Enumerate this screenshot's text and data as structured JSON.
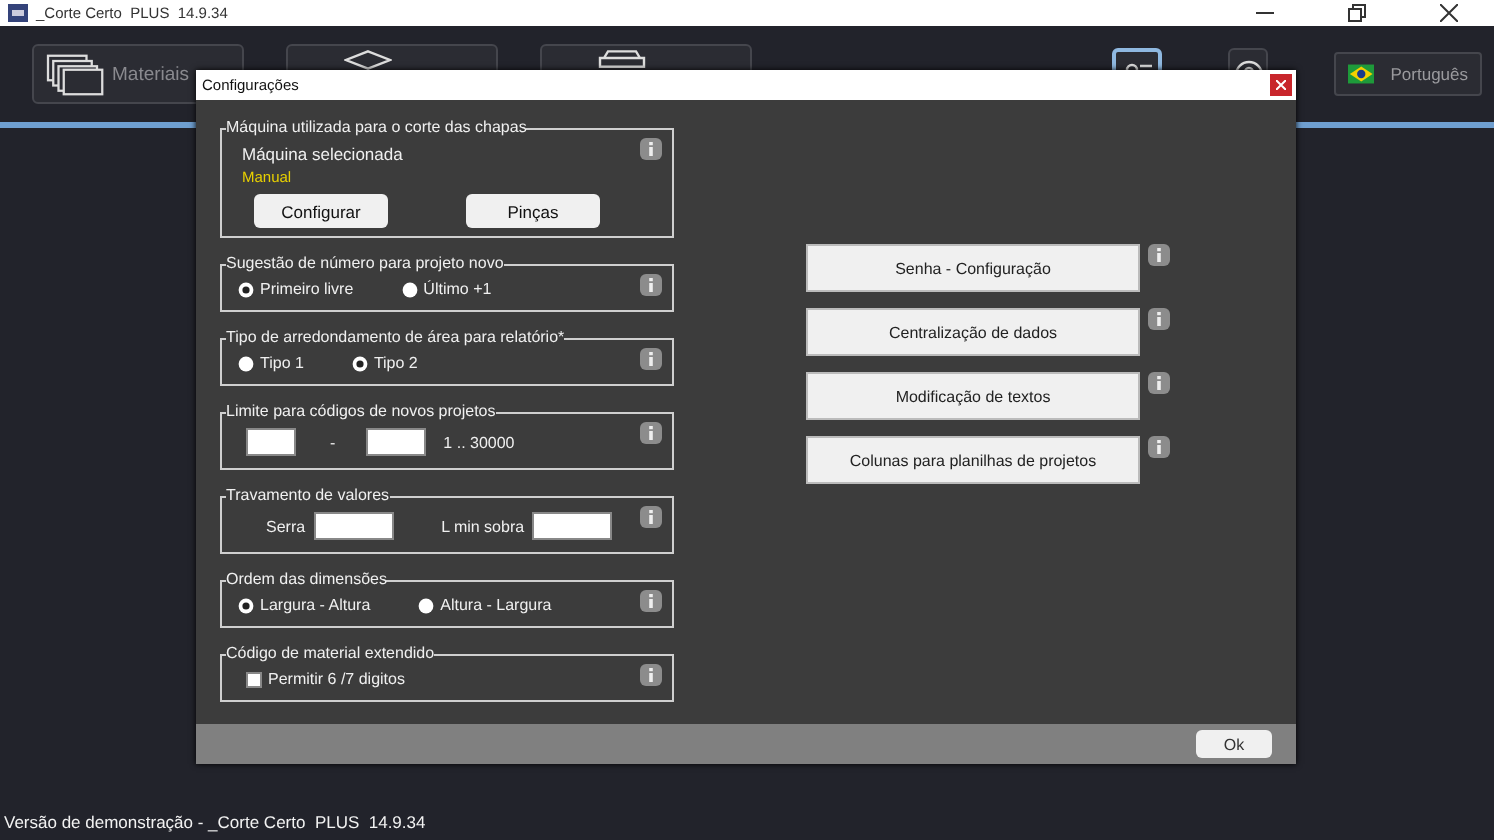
{
  "window": {
    "title": "_Corte Certo  PLUS  14.9.34"
  },
  "nav": [
    {
      "label": "Materiais",
      "kind": "sheets"
    },
    {
      "kind": "layers"
    },
    {
      "kind": "tray"
    }
  ],
  "toolbar": {
    "settings_selected": true,
    "help_selected": false,
    "language": "Português"
  },
  "dialog": {
    "title": "Configurações",
    "groups": [
      {
        "kind": "machine",
        "title": "Máquina utilizada para o corte das chapas",
        "label": "Máquina selecionada",
        "value": "Manual",
        "buttons": [
          "Configurar",
          "Pinças"
        ]
      },
      {
        "kind": "radios",
        "title": "Sugestão de número para projeto novo",
        "options": [
          {
            "label": "Primeiro livre",
            "selected": true
          },
          {
            "label": "Último +1",
            "selected": false
          }
        ]
      },
      {
        "kind": "radios",
        "title": "Tipo de arredondamento de área para relatório*",
        "options": [
          {
            "label": "Tipo 1",
            "selected": false
          },
          {
            "label": "Tipo 2",
            "selected": true
          }
        ]
      },
      {
        "kind": "range",
        "title": "Limite para códigos de novos projetos",
        "separator": "-",
        "hint": "1 .. 30000"
      },
      {
        "kind": "fields",
        "title": "Travamento de valores",
        "fields": [
          {
            "label": "Serra"
          },
          {
            "label": "L min sobra"
          }
        ]
      },
      {
        "kind": "radios",
        "title": "Ordem das dimensões",
        "options": [
          {
            "label": "Largura - Altura",
            "selected": true
          },
          {
            "label": "Altura - Largura",
            "selected": false
          }
        ]
      },
      {
        "kind": "checkbox",
        "title": "Código de material extendido",
        "label": "Permitir 6 /7 digitos",
        "checked": false
      }
    ],
    "buttons": [
      "Senha - Configuração",
      "Centralização de dados",
      "Modificação de textos",
      "Colunas para planilhas de projetos"
    ],
    "ok": "Ok"
  },
  "status_bar": "Versão de demonstração - _Corte Certo  PLUS  14.9.34"
}
